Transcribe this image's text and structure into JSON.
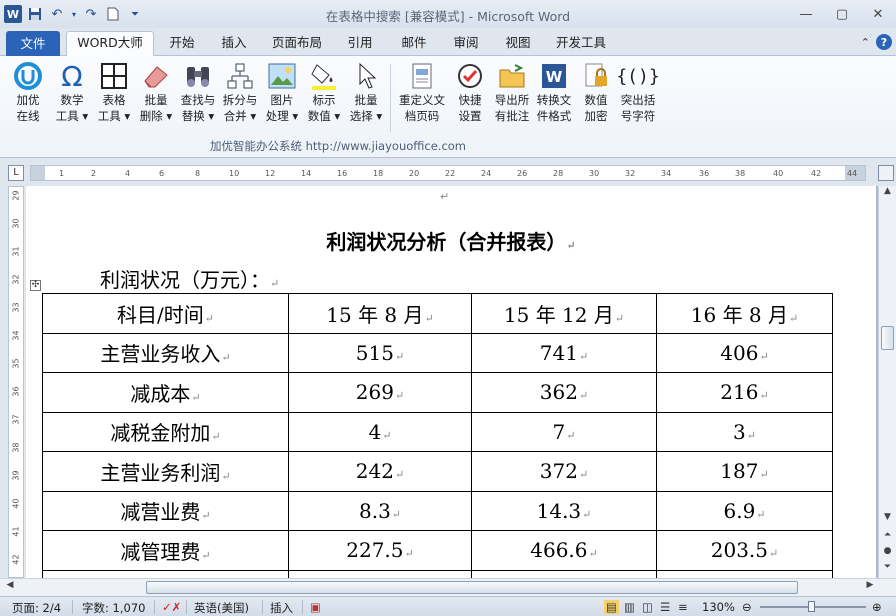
{
  "window": {
    "title": "在表格中搜索 [兼容模式] - Microsoft Word",
    "app_icon_label": "W"
  },
  "tabs": [
    {
      "label": "文件"
    },
    {
      "label": "WORD大师"
    },
    {
      "label": "开始"
    },
    {
      "label": "插入"
    },
    {
      "label": "页面布局"
    },
    {
      "label": "引用"
    },
    {
      "label": "邮件"
    },
    {
      "label": "审阅"
    },
    {
      "label": "视图"
    },
    {
      "label": "开发工具"
    }
  ],
  "ribbon": {
    "buttons": [
      {
        "line1": "加优",
        "line2": "在线",
        "icon": "jiayou-logo-icon"
      },
      {
        "line1": "数学",
        "line2": "工具 ▾",
        "icon": "omega-icon"
      },
      {
        "line1": "表格",
        "line2": "工具 ▾",
        "icon": "table-icon"
      },
      {
        "line1": "批量",
        "line2": "删除 ▾",
        "icon": "eraser-icon"
      },
      {
        "line1": "查找与",
        "line2": "替换 ▾",
        "icon": "binoculars-icon"
      },
      {
        "line1": "拆分与",
        "line2": "合并 ▾",
        "icon": "split-merge-icon"
      },
      {
        "line1": "图片",
        "line2": "处理 ▾",
        "icon": "picture-icon"
      },
      {
        "line1": "标示",
        "line2": "数值 ▾",
        "icon": "highlight-bucket-icon"
      },
      {
        "line1": "批量",
        "line2": "选择 ▾",
        "icon": "cursor-icon"
      },
      {
        "line1": "重定义文",
        "line2": "档页码",
        "icon": "page-number-icon"
      },
      {
        "line1": "快捷",
        "line2": "设置",
        "icon": "quick-settings-icon"
      },
      {
        "line1": "导出所",
        "line2": "有批注",
        "icon": "export-comments-icon"
      },
      {
        "line1": "转换文",
        "line2": "件格式",
        "icon": "convert-format-icon"
      },
      {
        "line1": "数值",
        "line2": "加密",
        "icon": "lock-icon"
      },
      {
        "line1": "突出括",
        "line2": "号字符",
        "icon": "brackets-icon"
      }
    ],
    "footer": "加优智能办公系统   http://www.jiayouoffice.com"
  },
  "ruler": {
    "h_ticks": [
      "1",
      "2",
      "4",
      "6",
      "8",
      "10",
      "12",
      "14",
      "16",
      "18",
      "20",
      "22",
      "24",
      "26",
      "28",
      "30",
      "32",
      "34",
      "36",
      "38",
      "40",
      "42",
      "44"
    ],
    "v_ticks": [
      "29",
      "30",
      "31",
      "32",
      "33",
      "34",
      "35",
      "36",
      "37",
      "38",
      "39",
      "40",
      "41",
      "42"
    ],
    "corner_label": "L"
  },
  "document": {
    "title": "利润状况分析（合并报表）",
    "subhead": "利润状况（万元）：",
    "para_mark": "↵",
    "table": {
      "header": [
        "科目/时间",
        "15 年 8 月",
        "15 年 12 月",
        "16 年 8 月"
      ],
      "rows": [
        [
          "主营业务收入",
          "515",
          "741",
          "406"
        ],
        [
          "减成本",
          "269",
          "362",
          "216"
        ],
        [
          "减税金附加",
          "4",
          "7",
          "3"
        ],
        [
          "主营业务利润",
          "242",
          "372",
          "187"
        ],
        [
          "减营业费",
          "8.3",
          "14.3",
          "6.9"
        ],
        [
          "减管理费",
          "227.5",
          "466.6",
          "203.5"
        ]
      ]
    }
  },
  "statusbar": {
    "page": "页面: 2/4",
    "words": "字数: 1,070",
    "language": "英语(美国)",
    "mode": "插入",
    "zoom": "130%",
    "zoom_level": 1.3
  },
  "colors": {
    "file_tab": "#2b63b8",
    "ribbon_bg": "#fbfcfe",
    "doc_bg": "#abb9cc"
  }
}
